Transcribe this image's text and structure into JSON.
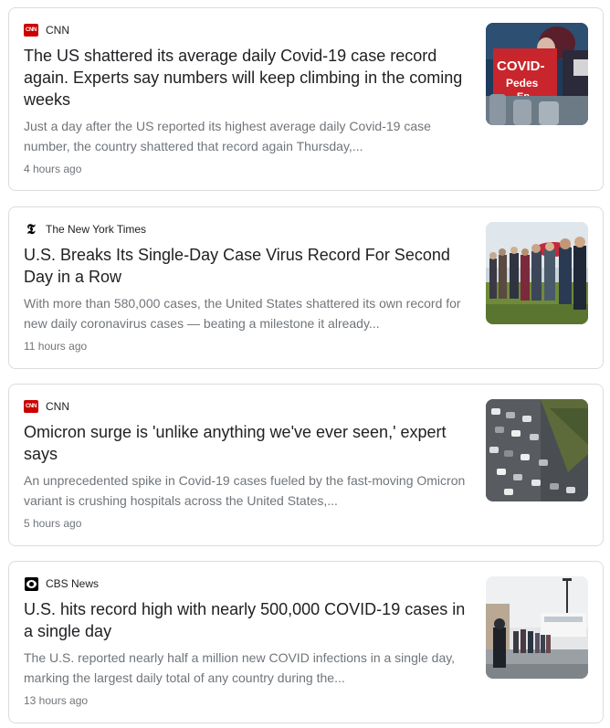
{
  "articles": [
    {
      "source": "CNN",
      "logo": "cnn-logo",
      "logo_text": "CNN",
      "headline": "The US shattered its average daily Covid-19 case record again. Experts say numbers will keep climbing in the coming weeks",
      "snippet": "Just a day after the US reported its highest average daily Covid-19 case number, the country shattered that record again Thursday,...",
      "time": "4 hours ago",
      "thumbnail": "covid-testing-sign-photo",
      "thumb_sign_line1": "COVID-",
      "thumb_sign_line2": "Pedes",
      "thumb_sign_line3": "En"
    },
    {
      "source": "The New York Times",
      "logo": "nyt-logo",
      "logo_text": "𝕿",
      "headline": "U.S. Breaks Its Single-Day Case Virus Record For Second Day in a Row",
      "snippet": "With more than 580,000 cases, the United States shattered its own record for new daily coronavirus cases — beating a milestone it already...",
      "time": "11 hours ago",
      "thumbnail": "people-waiting-in-line-photo"
    },
    {
      "source": "CNN",
      "logo": "cnn-logo",
      "logo_text": "CNN",
      "headline": "Omicron surge is 'unlike anything we've ever seen,' expert says",
      "snippet": "An unprecedented spike in Covid-19 cases fueled by the fast-moving Omicron variant is crushing hospitals across the United States,...",
      "time": "5 hours ago",
      "thumbnail": "cars-queue-aerial-photo"
    },
    {
      "source": "CBS News",
      "logo": "cbs-logo",
      "logo_text": "",
      "headline": "U.S. hits record high with nearly 500,000 COVID-19 cases in a single day",
      "snippet": "The U.S. reported nearly half a million new COVID infections in a single day, marking the largest daily total of any country during the...",
      "time": "13 hours ago",
      "thumbnail": "testing-site-line-photo"
    }
  ],
  "colors": {
    "headline": "#202124",
    "snippet": "#70757a",
    "border": "#dadce0",
    "cnn_red": "#cc0000"
  }
}
